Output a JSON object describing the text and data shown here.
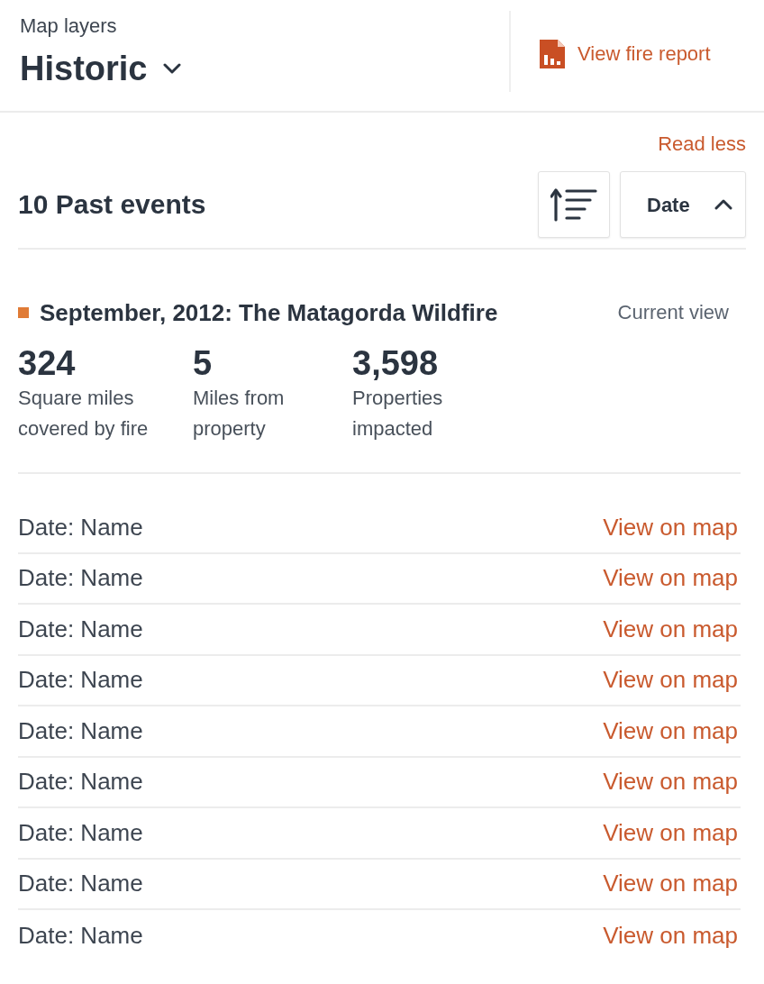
{
  "header": {
    "label": "Map layers",
    "layer_dropdown": {
      "value": "Historic",
      "expanded": false
    },
    "report_link": "View fire report"
  },
  "read_less": "Read less",
  "events_header": {
    "title": "10 Past events",
    "sort_field": {
      "value": "Date",
      "expanded": true
    }
  },
  "current_event": {
    "title": "September, 2012: The Matagorda Wildfire",
    "status": "Current view",
    "stats": [
      {
        "value": "324",
        "label": "Square miles covered by fire"
      },
      {
        "value": "5",
        "label": "Miles from property"
      },
      {
        "value": "3,598",
        "label": "Properties impacted"
      }
    ]
  },
  "past_events": [
    {
      "name": "Date: Name",
      "action": "View on map"
    },
    {
      "name": "Date: Name",
      "action": "View on map"
    },
    {
      "name": "Date: Name",
      "action": "View on map"
    },
    {
      "name": "Date: Name",
      "action": "View on map"
    },
    {
      "name": "Date: Name",
      "action": "View on map"
    },
    {
      "name": "Date: Name",
      "action": "View on map"
    },
    {
      "name": "Date: Name",
      "action": "View on map"
    },
    {
      "name": "Date: Name",
      "action": "View on map"
    },
    {
      "name": "Date: Name",
      "action": "View on map"
    }
  ]
}
